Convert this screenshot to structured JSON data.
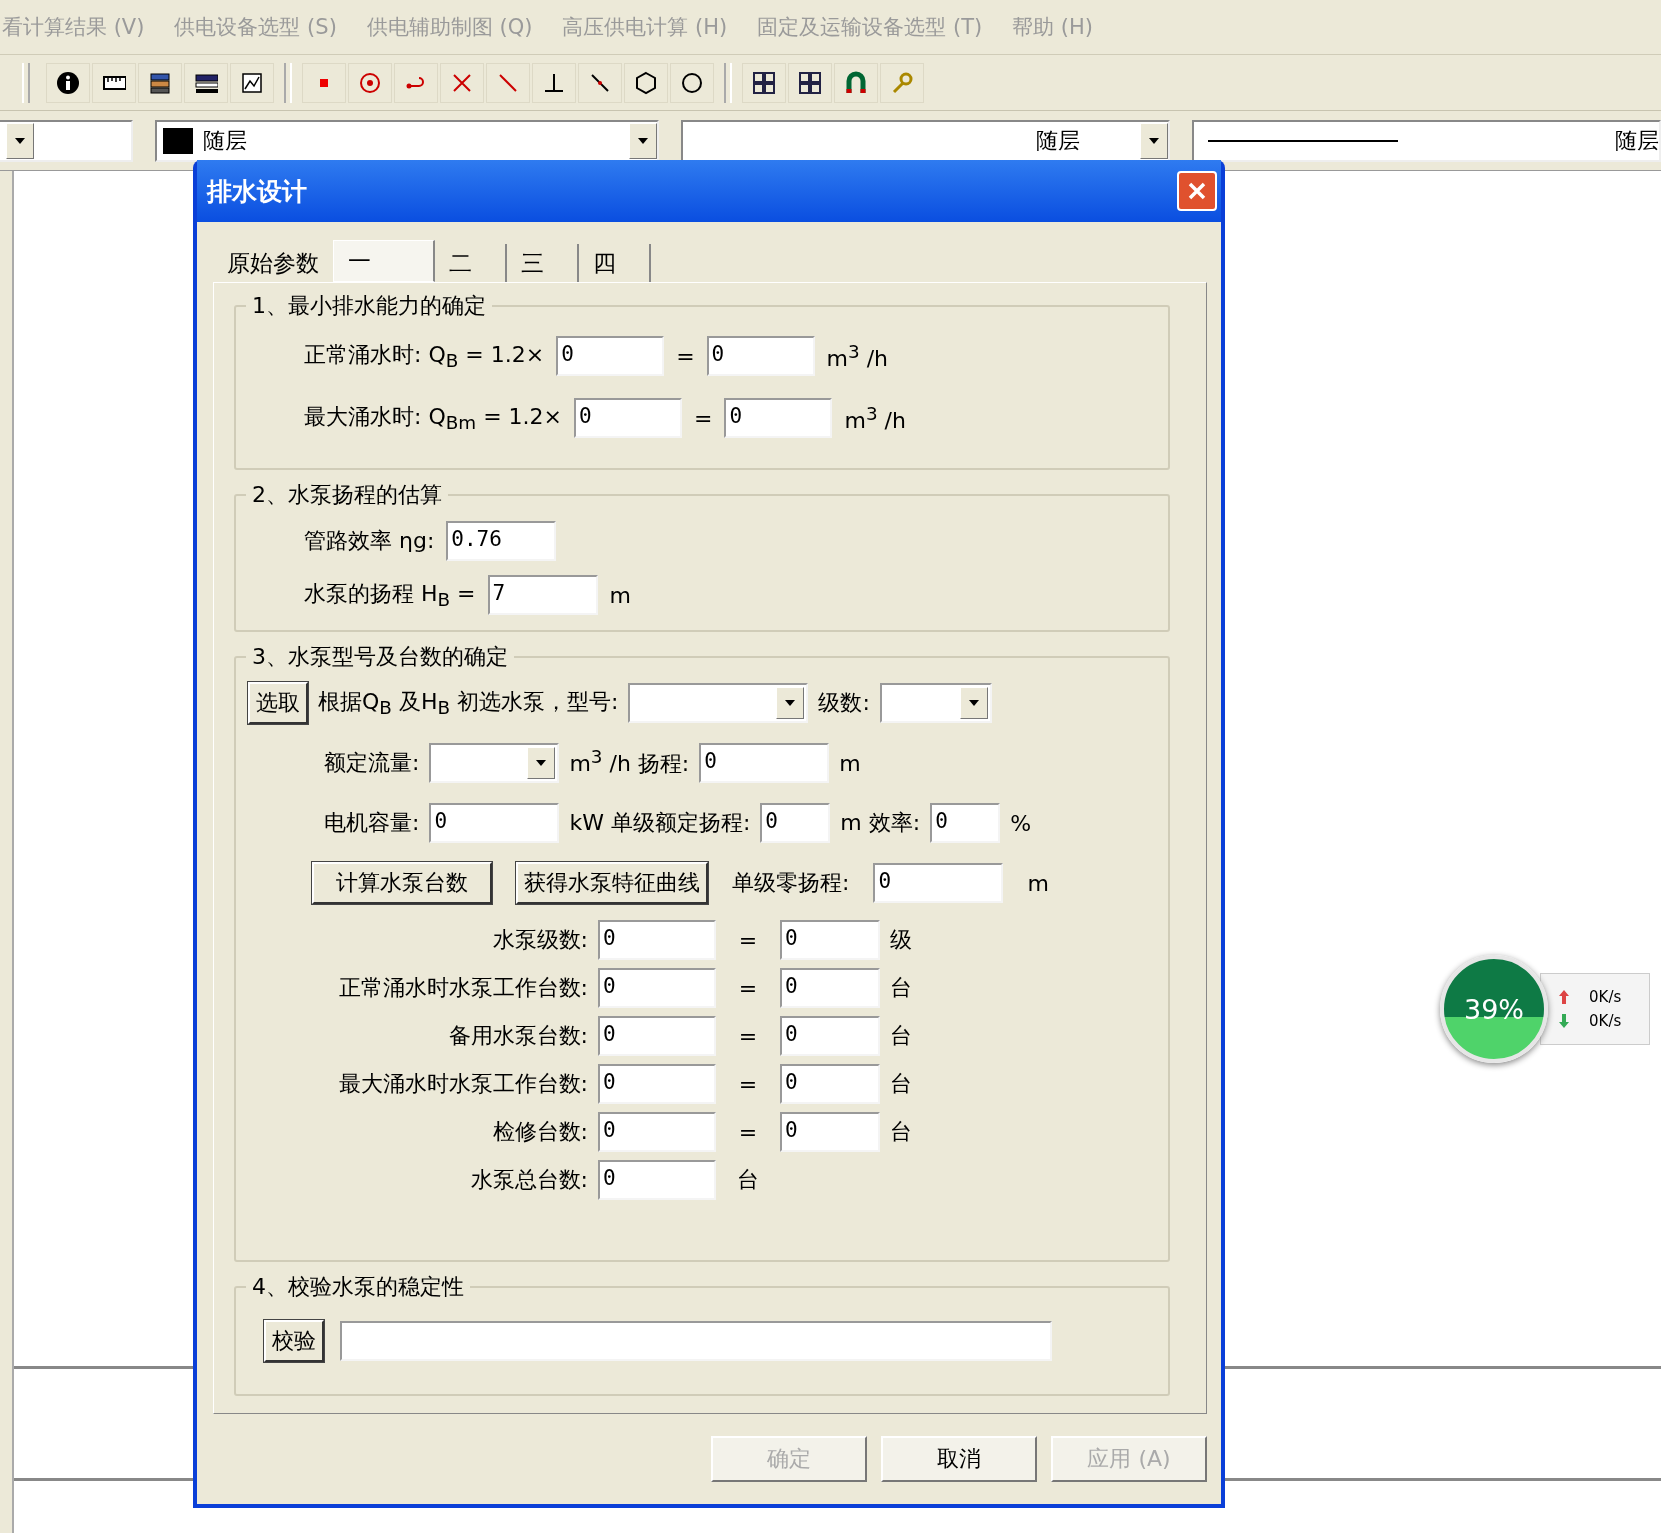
{
  "menu": [
    "看计算结果 (V)",
    "供电设备选型 (S)",
    "供电辅助制图 (Q)",
    "高压供电计算 (H)",
    "固定及运输设备选型 (T)",
    "帮助 (H)"
  ],
  "property_bar": {
    "color_label": "随层",
    "linetype": "随层",
    "lineweight": "随层"
  },
  "dialog": {
    "title": "排水设计",
    "tabs": [
      {
        "label": "原始参数",
        "selected": false
      },
      {
        "label": "一",
        "selected": true
      },
      {
        "label": "二",
        "selected": false
      },
      {
        "label": "三",
        "selected": false
      },
      {
        "label": "四",
        "selected": false
      }
    ],
    "sections": [
      {
        "title": "1、最小排水能力的确定",
        "lines": [
          [
            {
              "kind": "text",
              "text": "正常涌水时: Q$_{B}$ = 1.2×"
            },
            {
              "kind": "input",
              "value": "0"
            },
            {
              "kind": "text",
              "text": "="
            },
            {
              "kind": "input",
              "value": "0"
            },
            {
              "kind": "text",
              "text": "m$^{3}$ /h"
            }
          ],
          [
            {
              "kind": "text",
              "text": "最大涌水时: Q$_{Bm}$ = 1.2×"
            },
            {
              "kind": "input",
              "value": "0"
            },
            {
              "kind": "text",
              "text": "="
            },
            {
              "kind": "input",
              "value": "0"
            },
            {
              "kind": "text",
              "text": "m$^{3}$ /h"
            }
          ]
        ]
      },
      {
        "title": "2、水泵扬程的估算",
        "lines": [
          [
            {
              "kind": "text",
              "text": "管路效率 ηg:"
            },
            {
              "kind": "input",
              "value": "0.76"
            }
          ],
          [
            {
              "kind": "text",
              "text": "水泵的扬程 H$_{B}$ ="
            },
            {
              "kind": "input",
              "value": "7"
            },
            {
              "kind": "text",
              "text": "m"
            }
          ]
        ]
      },
      {
        "title": "3、水泵型号及台数的确定",
        "lines": [
          [
            {
              "kind": "button",
              "text": "选取"
            },
            {
              "kind": "text",
              "text": "根据Q$_{B}$ 及H$_{B}$ 初选水泵，型号:"
            },
            {
              "kind": "combo"
            },
            {
              "kind": "text",
              "text": "级数:"
            },
            {
              "kind": "small_combo"
            }
          ],
          [
            {
              "kind": "text",
              "text": "额定流量:"
            },
            {
              "kind": "small_combo"
            },
            {
              "kind": "text",
              "text": "m$^{3}$ /h 扬程:"
            },
            {
              "kind": "input",
              "value": "0"
            },
            {
              "kind": "text",
              "text": "m"
            }
          ],
          [
            {
              "kind": "text",
              "text": "电机容量:"
            },
            {
              "kind": "input",
              "value": "0"
            },
            {
              "kind": "text",
              "text": "kW 单级额定扬程:"
            },
            {
              "kind": "small_input",
              "value": "0"
            },
            {
              "kind": "text",
              "text": "m 效率:"
            },
            {
              "kind": "small_input",
              "value": "0"
            },
            {
              "kind": "text",
              "text": "%"
            }
          ],
          [
            {
              "kind": "button",
              "text": "计算水泵台数"
            },
            {
              "kind": "button",
              "text": "获得水泵特征曲线"
            },
            {
              "kind": "text",
              "text": "单级零扬程:"
            },
            {
              "kind": "input",
              "value": "0"
            },
            {
              "kind": "text",
              "text": "m"
            }
          ]
        ],
        "count_rows": [
          {
            "label": "水泵级数:",
            "value": "0",
            "eq": "=",
            "result": "0",
            "unit": "级"
          },
          {
            "label": "正常涌水时水泵工作台数:",
            "value": "0",
            "eq": "=",
            "result": "0",
            "unit": "台"
          },
          {
            "label": "备用水泵台数:",
            "value": "0",
            "eq": "=",
            "result": "0",
            "unit": "台"
          },
          {
            "label": "最大涌水时水泵工作台数:",
            "value": "0",
            "eq": "=",
            "result": "0",
            "unit": "台"
          },
          {
            "label": "检修台数:",
            "value": "0",
            "eq": "=",
            "result": "0",
            "unit": "台"
          },
          {
            "label": "水泵总台数:",
            "value": "0",
            "unit": "台"
          }
        ]
      },
      {
        "title": "4、校验水泵的稳定性",
        "lines": [
          [
            {
              "kind": "button",
              "text": "校验"
            },
            {
              "kind": "long_input"
            }
          ]
        ]
      }
    ],
    "buttons": [
      {
        "label": "确定",
        "disabled": true
      },
      {
        "label": "取消",
        "disabled": false
      },
      {
        "label": "应用 (A)",
        "disabled": true
      }
    ]
  },
  "speed_widget": {
    "percent": "39%",
    "upload": "0K/s",
    "download": "0K/s"
  }
}
